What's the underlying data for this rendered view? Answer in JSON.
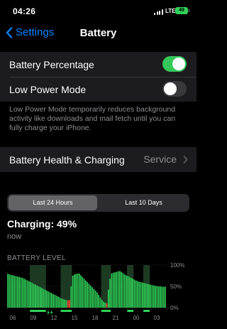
{
  "status_bar": {
    "time": "04:26",
    "network": "LTE",
    "battery": "49"
  },
  "nav": {
    "back_label": "Settings",
    "title": "Battery"
  },
  "settings": {
    "battery_percentage": {
      "label": "Battery Percentage",
      "enabled": true
    },
    "low_power_mode": {
      "label": "Low Power Mode",
      "enabled": false
    },
    "footnote": "Low Power Mode temporarily reduces background activity like downloads and mail fetch until you can fully charge your iPhone."
  },
  "battery_health": {
    "label": "Battery Health & Charging",
    "detail": "Service"
  },
  "segments": {
    "selected": "Last 24 Hours",
    "other": "Last 10 Days"
  },
  "charging": {
    "status": "Charging: 49%",
    "time": "now"
  },
  "chart_data": {
    "type": "bar",
    "title": "BATTERY LEVEL",
    "y_tick_labels": [
      "100%",
      "50%",
      "0%"
    ],
    "x_tick_labels": [
      "06",
      "09",
      "12",
      "15",
      "18",
      "21",
      "00",
      "03"
    ],
    "ylim": [
      0,
      100
    ],
    "colors": {
      "normal": "#30d158",
      "low": "#ff453a",
      "charging_band": "#1c3a22",
      "grid": "#3a3a3c"
    },
    "values": [
      80,
      78,
      77,
      76,
      75,
      74,
      73,
      72,
      71,
      70,
      68,
      66,
      64,
      62,
      60,
      58,
      56,
      54,
      52,
      50,
      48,
      46,
      44,
      42,
      40,
      38,
      36,
      34,
      32,
      30,
      28,
      26,
      24,
      22,
      20,
      19,
      18,
      17,
      18,
      50,
      75,
      78,
      79,
      80,
      80,
      76,
      72,
      68,
      64,
      60,
      56,
      52,
      48,
      44,
      40,
      36,
      30,
      24,
      18,
      14,
      12,
      10,
      42,
      68,
      80,
      82,
      83,
      84,
      85,
      86,
      84,
      81,
      78,
      76,
      74,
      72,
      70,
      68,
      66,
      64,
      62,
      61,
      60,
      59,
      58,
      57,
      56,
      55,
      54,
      53,
      52,
      51,
      51,
      50,
      50,
      49,
      49,
      49
    ],
    "low_indices": [
      37,
      38,
      61
    ],
    "charging_bands": [
      [
        14,
        24
      ],
      [
        33,
        40
      ],
      [
        58,
        64
      ],
      [
        74,
        78
      ],
      [
        84,
        88
      ]
    ]
  }
}
